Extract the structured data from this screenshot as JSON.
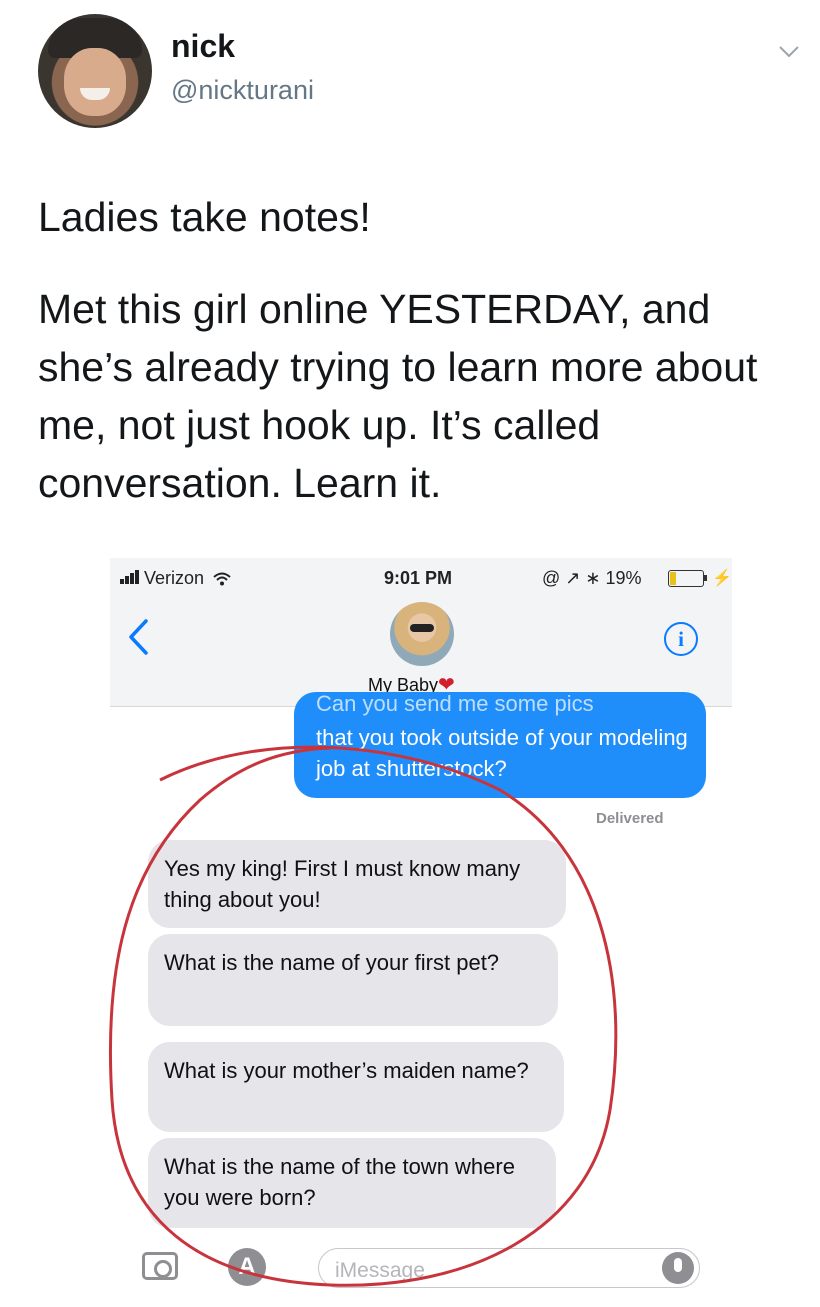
{
  "tweet": {
    "author_name": "nick",
    "author_handle": "@nickturani",
    "paragraph_1": "Ladies take notes!",
    "paragraph_2": "Met this girl online YESTERDAY, and she’s already trying to learn more about me, not just hook up. It’s called conversation. Learn it."
  },
  "phone": {
    "status_bar": {
      "carrier": "Verizon",
      "time": "9:01 PM",
      "battery_percent": "19%",
      "battery_level": 0.19
    },
    "contact_name": "My Baby",
    "heart_symbol": "❤",
    "info_symbol": "i",
    "sent_message_cutoff": "Can you send me some pics",
    "sent_message": "that you took outside of your modeling job at shutterstock?",
    "delivered_label": "Delivered",
    "received_messages": [
      "Yes my king! First I must know many thing about you!",
      "What is the name of your first pet?",
      "What is your mother’s maiden name?",
      "What is the name of the town where you were born?"
    ],
    "input_placeholder": "iMessage",
    "appstore_symbol": "A"
  },
  "colors": {
    "imessage_blue": "#1f8efa",
    "received_gray": "#e5e5ea",
    "annotation_red": "#c8343c",
    "twitter_gray": "#657786"
  },
  "icons": [
    "chevron-down-icon",
    "back-chevron-icon",
    "info-icon",
    "camera-icon",
    "appstore-icon",
    "microphone-icon",
    "signal-icon",
    "wifi-icon",
    "battery-icon"
  ]
}
